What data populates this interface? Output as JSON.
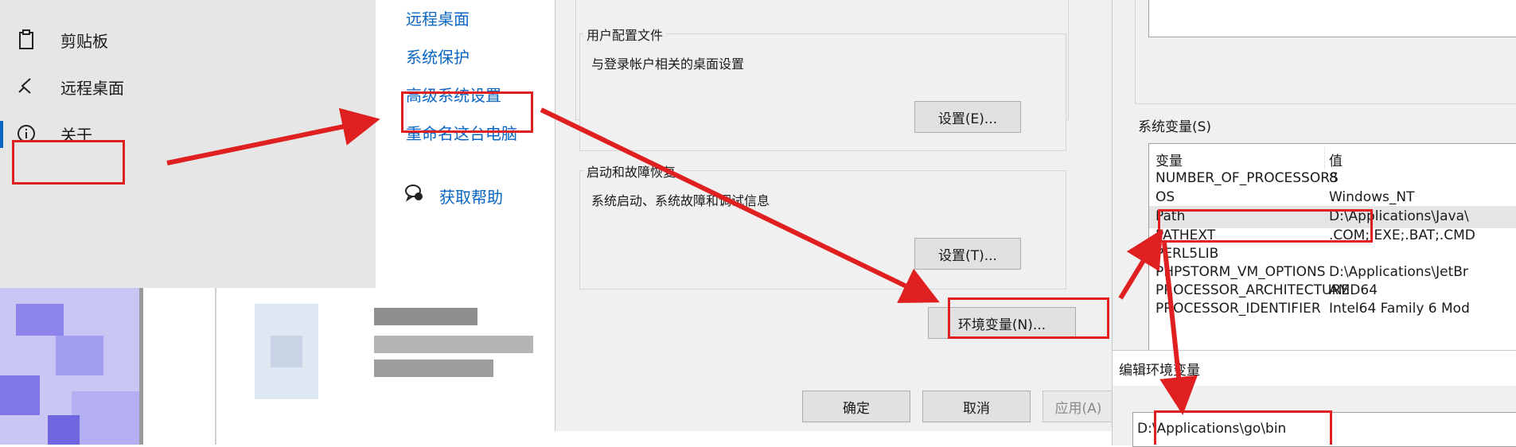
{
  "settings_nav": {
    "items": [
      {
        "label": "剪贴板",
        "icon": "clipboard-icon"
      },
      {
        "label": "远程桌面",
        "icon": "remote-desktop-icon"
      },
      {
        "label": "关于",
        "icon": "info-icon"
      }
    ]
  },
  "related_links": {
    "remote_desktop": "远程桌面",
    "system_protection": "系统保护",
    "advanced_settings": "高级系统设置",
    "rename_pc": "重命名这台电脑",
    "get_help": "获取帮助",
    "help_icon": "help-chat-icon"
  },
  "system_properties": {
    "user_profiles": {
      "title": "用户配置文件",
      "description": "与登录帐户相关的桌面设置",
      "button": "设置(E)..."
    },
    "startup_recovery": {
      "title": "启动和故障恢复",
      "description": "系统启动、系统故障和调试信息",
      "button": "设置(T)..."
    },
    "env_button": "环境变量(N)...",
    "ok": "确定",
    "cancel": "取消",
    "apply": "应用(A)"
  },
  "environment_variables": {
    "system_vars_label": "系统变量(S)",
    "columns": [
      "变量",
      "值"
    ],
    "rows": [
      {
        "name": "NUMBER_OF_PROCESSORS",
        "value": "8"
      },
      {
        "name": "OS",
        "value": "Windows_NT"
      },
      {
        "name": "Path",
        "value": "D:\\Applications\\Java\\"
      },
      {
        "name": "PATHEXT",
        "value": ".COM;.EXE;.BAT;.CMD"
      },
      {
        "name": "PERL5LIB",
        "value": ""
      },
      {
        "name": "PHPSTORM_VM_OPTIONS",
        "value": "D:\\Applications\\JetBr"
      },
      {
        "name": "PROCESSOR_ARCHITECTURE",
        "value": "AMD64"
      },
      {
        "name": "PROCESSOR_IDENTIFIER",
        "value": "Intel64 Family 6 Mod"
      }
    ]
  },
  "edit_env": {
    "title": "编辑环境变量",
    "entry": "D:\\Applications\\go\\bin"
  },
  "colors": {
    "highlight": "#e02020",
    "link": "#0a66c2",
    "selection": "#e5e5e5"
  }
}
